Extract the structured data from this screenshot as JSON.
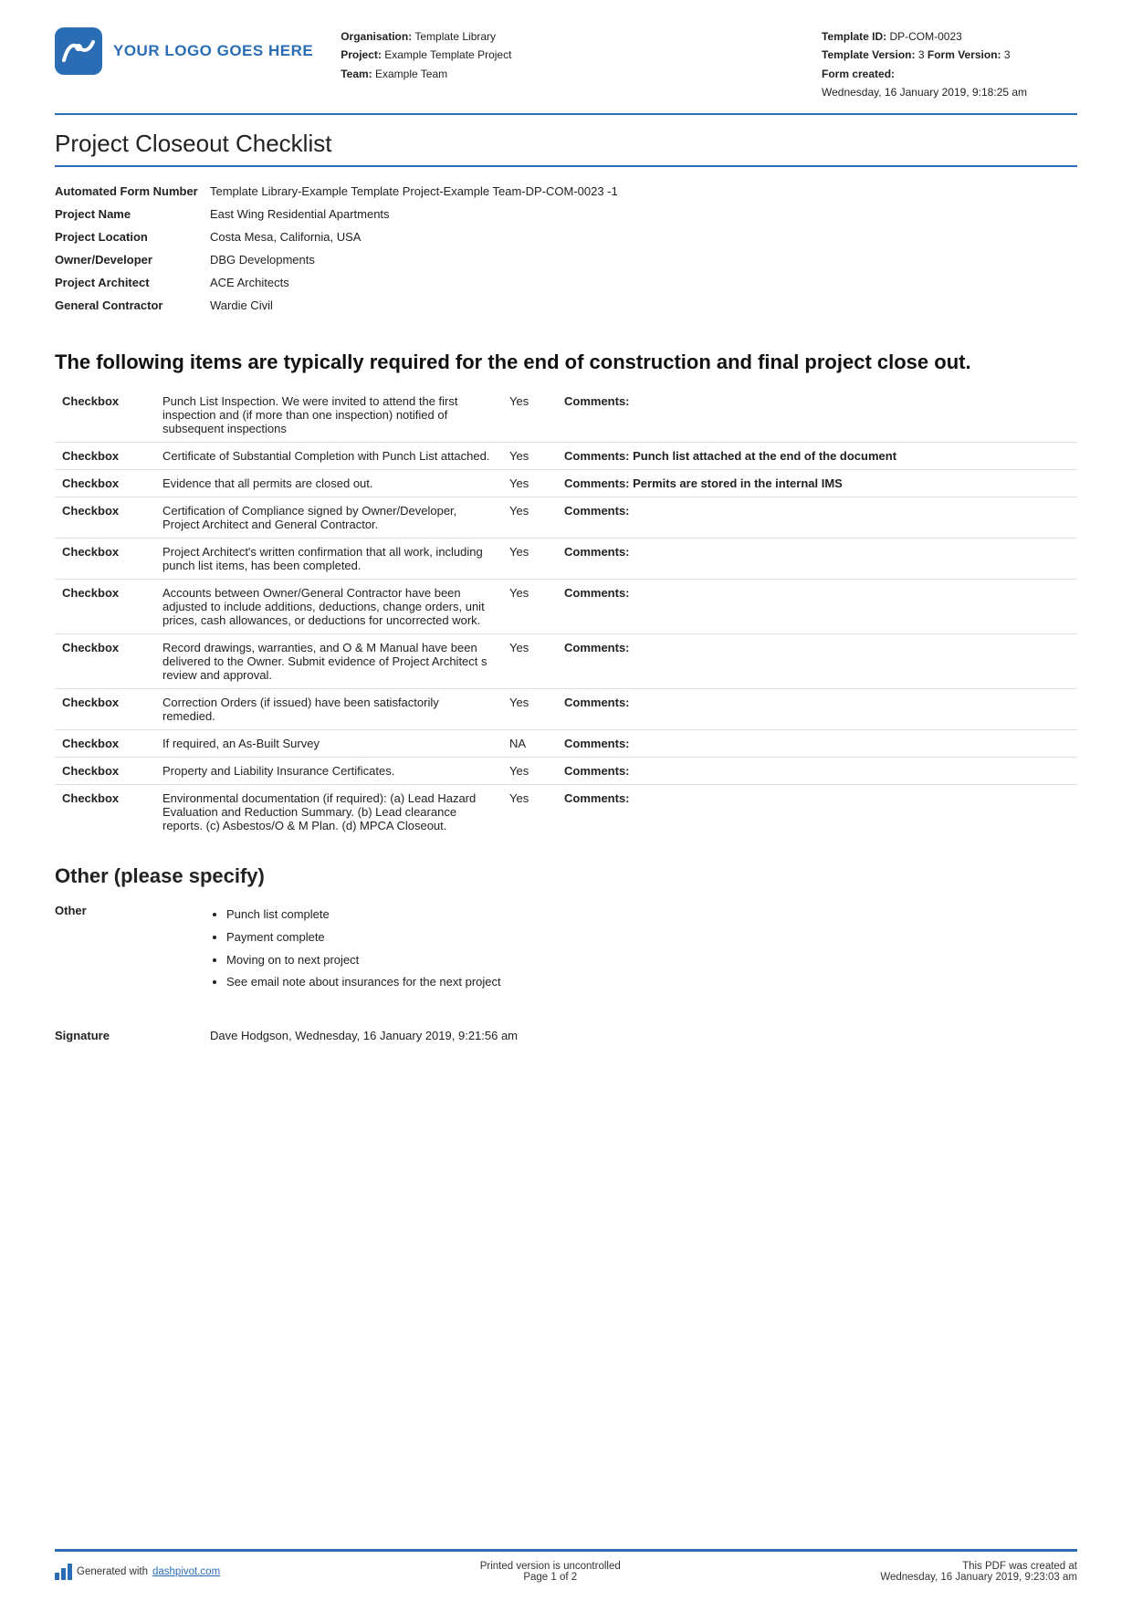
{
  "header": {
    "logo_text": "YOUR LOGO GOES HERE",
    "org_label": "Organisation:",
    "org_value": "Template Library",
    "project_label": "Project:",
    "project_value": "Example Template Project",
    "team_label": "Team:",
    "team_value": "Example Team",
    "template_id_label": "Template ID:",
    "template_id_value": "DP-COM-0023",
    "template_version_label": "Template Version:",
    "template_version_value": "3",
    "form_version_label": "Form Version:",
    "form_version_value": "3",
    "form_created_label": "Form created:",
    "form_created_value": "Wednesday, 16 January 2019, 9:18:25 am"
  },
  "doc_title": "Project Closeout Checklist",
  "info_rows": [
    {
      "label": "Automated Form Number",
      "value": "Template Library-Example Template Project-Example Team-DP-COM-0023   -1"
    },
    {
      "label": "Project Name",
      "value": "East Wing Residential Apartments"
    },
    {
      "label": "Project Location",
      "value": "Costa Mesa, California, USA"
    },
    {
      "label": "Owner/Developer",
      "value": "DBG Developments"
    },
    {
      "label": "Project Architect",
      "value": "ACE Architects"
    },
    {
      "label": "General Contractor",
      "value": "Wardie Civil"
    }
  ],
  "section_heading": "The following items are typically required for the end of construction and final project close out.",
  "checklist_items": [
    {
      "col1": "Checkbox",
      "col2": "Punch List Inspection. We were invited to attend the first inspection and (if more than one inspection) notified of subsequent inspections",
      "col3": "Yes",
      "col4": "Comments:"
    },
    {
      "col1": "Checkbox",
      "col2": "Certificate of Substantial Completion with Punch List attached.",
      "col3": "Yes",
      "col4": "Comments: Punch list attached at the end of the document"
    },
    {
      "col1": "Checkbox",
      "col2": "Evidence that all permits are closed out.",
      "col3": "Yes",
      "col4": "Comments: Permits are stored in the internal IMS"
    },
    {
      "col1": "Checkbox",
      "col2": "Certification of Compliance signed by Owner/Developer, Project Architect and General Contractor.",
      "col3": "Yes",
      "col4": "Comments:"
    },
    {
      "col1": "Checkbox",
      "col2": "Project Architect's written confirmation that all work, including punch list items, has been completed.",
      "col3": "Yes",
      "col4": "Comments:"
    },
    {
      "col1": "Checkbox",
      "col2": "Accounts between Owner/General Contractor have been adjusted to include additions, deductions, change orders, unit prices, cash allowances, or deductions for uncorrected work.",
      "col3": "Yes",
      "col4": "Comments:"
    },
    {
      "col1": "Checkbox",
      "col2": "Record drawings, warranties, and O & M Manual have been delivered to the Owner. Submit evidence of Project Architect s review and approval.",
      "col3": "Yes",
      "col4": "Comments:"
    },
    {
      "col1": "Checkbox",
      "col2": "Correction Orders (if issued) have been satisfactorily remedied.",
      "col3": "Yes",
      "col4": "Comments:"
    },
    {
      "col1": "Checkbox",
      "col2": "If required, an As-Built Survey",
      "col3": "NA",
      "col4": "Comments:"
    },
    {
      "col1": "Checkbox",
      "col2": "Property and Liability Insurance Certificates.",
      "col3": "Yes",
      "col4": "Comments:"
    },
    {
      "col1": "Checkbox",
      "col2": "Environmental documentation (if required): (a) Lead Hazard Evaluation and Reduction Summary. (b) Lead clearance reports. (c) Asbestos/O & M Plan. (d) MPCA Closeout.",
      "col3": "Yes",
      "col4": "Comments:"
    }
  ],
  "other_heading": "Other (please specify)",
  "other_label": "Other",
  "other_items": [
    "Punch list complete",
    "Payment complete",
    "Moving on to next project",
    "See email note about insurances for the next project"
  ],
  "signature_label": "Signature",
  "signature_value": "Dave Hodgson, Wednesday, 16 January 2019, 9:21:56 am",
  "footer": {
    "generated_text": "Generated with ",
    "link_text": "dashpivot.com",
    "center_line1": "Printed version is uncontrolled",
    "center_line2": "Page 1 of 2",
    "right_line1": "This PDF was created at",
    "right_line2": "Wednesday, 16 January 2019, 9:23:03 am"
  }
}
